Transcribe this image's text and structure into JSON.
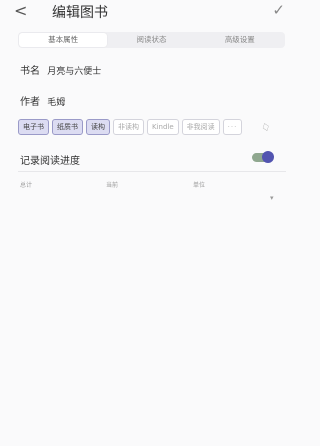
{
  "header": {
    "back_glyph": "<",
    "title": "编辑图书",
    "confirm_glyph": "✓"
  },
  "tabs": [
    {
      "label": "基本属性",
      "active": true
    },
    {
      "label": "阅读状态",
      "active": false
    },
    {
      "label": "高级设置",
      "active": false
    }
  ],
  "fields": {
    "book_name_label": "书名",
    "book_name_value": "月亮与六便士",
    "author_label": "作者",
    "author_value": "毛姆"
  },
  "tags": [
    {
      "label": "电子书",
      "selected": true
    },
    {
      "label": "纸质书",
      "selected": true
    },
    {
      "label": "读构",
      "selected": true
    },
    {
      "label": "非读构",
      "selected": false
    },
    {
      "label": "Kindle",
      "selected": false
    },
    {
      "label": "非我阅读",
      "selected": false
    }
  ],
  "tags_more": "···",
  "progress": {
    "label": "记录阅读进度",
    "enabled": true
  },
  "progress_columns": {
    "total": "总计",
    "current": "当前",
    "unit": "单位"
  },
  "colors": {
    "accent": "#5254b0",
    "toggle_track": "#8fa78f",
    "tag_selected_bg": "#dcdcf2"
  }
}
